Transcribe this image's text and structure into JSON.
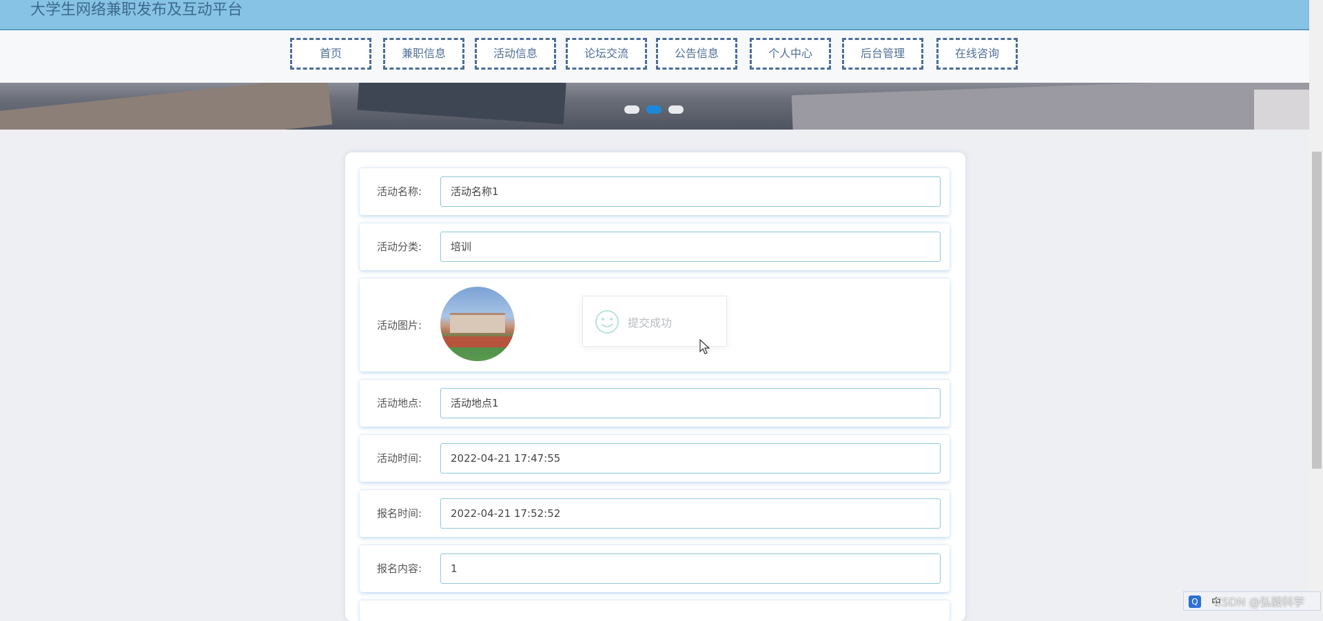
{
  "site": {
    "title": "大学生网络兼职发布及互动平台"
  },
  "nav": {
    "items": [
      "首页",
      "兼职信息",
      "活动信息",
      "论坛交流",
      "公告信息",
      "个人中心",
      "后台管理",
      "在线咨询"
    ]
  },
  "carousel": {
    "slide_count": 3,
    "active_index": 1,
    "active_color": "#1e88d8",
    "inactive_color": "#e8eaee"
  },
  "form": {
    "name": {
      "label": "活动名称:",
      "value": "活动名称1"
    },
    "category": {
      "label": "活动分类:",
      "value": "培训"
    },
    "image": {
      "label": "活动图片:"
    },
    "location": {
      "label": "活动地点:",
      "value": "活动地点1"
    },
    "activity_time": {
      "label": "活动时间:",
      "value": "2022-04-21 17:47:55"
    },
    "signup_time": {
      "label": "报名时间:",
      "value": "2022-04-21 17:52:52"
    },
    "signup_content": {
      "label": "报名内容:",
      "value": "1"
    }
  },
  "toast": {
    "text": "提交成功",
    "icon": "smile-icon"
  },
  "watermark": {
    "text": "CSDN @弘毅科学"
  },
  "ime": {
    "mode": "中"
  },
  "colors": {
    "header_bg": "#87c3e4",
    "nav_border": "#4a6d9a",
    "input_border": "#8fc7d6"
  }
}
